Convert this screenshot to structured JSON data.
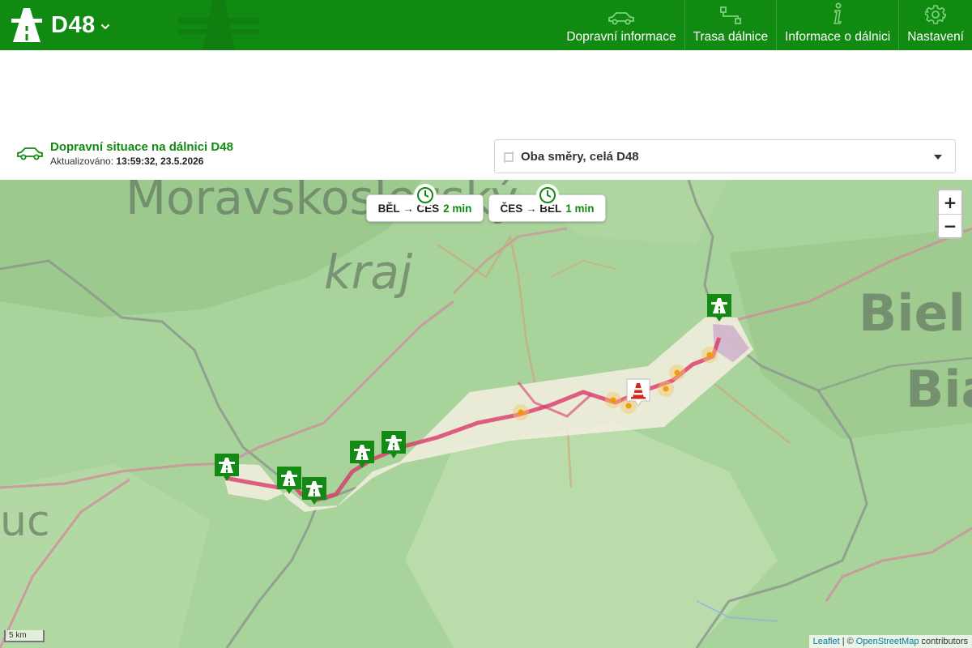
{
  "header": {
    "title": "D48",
    "brand_icon": "highway-icon",
    "nav": [
      {
        "label": "Dopravní informace",
        "icon": "car-icon"
      },
      {
        "label": "Trasa dálnice",
        "icon": "route-icon"
      },
      {
        "label": "Informace o dálnici",
        "icon": "info-icon"
      },
      {
        "label": "Nastavení",
        "icon": "gear-icon"
      }
    ]
  },
  "status": {
    "title": "Dopravní situace na dálnici D48",
    "updated_label": "Aktualizováno:",
    "updated_value": "13:59:32, 23.5.2026"
  },
  "direction_select": {
    "value": "Oba směry, celá D48"
  },
  "travel_times": [
    {
      "route": "BĚL → ČES",
      "time": "2 min"
    },
    {
      "route": "ČES → BĚL",
      "time": "1 min"
    }
  ],
  "map": {
    "labels": [
      "Moravskoslezský",
      "kraj",
      "Biel",
      "Bia",
      "uc"
    ],
    "zoom_in": "+",
    "zoom_out": "−",
    "scale": "5 km",
    "attribution": {
      "leaflet": "Leaflet",
      "separator": "| ©",
      "osm": "OpenStreetMap",
      "suffix": "contributors"
    }
  },
  "colors": {
    "brand_green": "#118a11",
    "congestion": "#d9386a",
    "incident_dot": "#f5a623",
    "roadwork_red": "#d7261b"
  }
}
